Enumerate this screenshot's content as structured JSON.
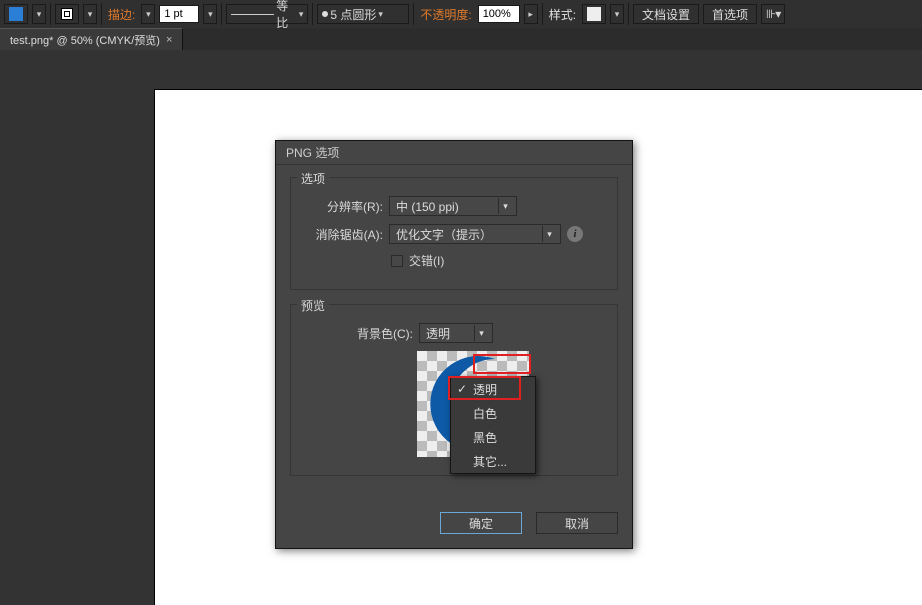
{
  "topbar": {
    "fill_color": "#2a7ed6",
    "stroke_mode_color": "#ffffff",
    "stroke_label": "描边:",
    "stroke_width": "1 pt",
    "dash_label": "等比",
    "brush_label": "5 点圆形",
    "opacity_label": "不透明度:",
    "opacity_value": "100%",
    "style_label": "样式:",
    "docsetup": "文档设置",
    "prefs": "首选项"
  },
  "tab": {
    "title": "test.png* @ 50% (CMYK/预览)"
  },
  "dialog": {
    "title": "PNG 选项",
    "group_options": "选项",
    "resolution_label": "分辨率(R):",
    "resolution_value": "中 (150 ppi)",
    "antialias_label": "消除锯齿(A):",
    "antialias_value": "优化文字（提示）",
    "interlaced_label": "交错(I)",
    "group_preview": "预览",
    "bgcolor_label": "背景色(C):",
    "bgcolor_value": "透明",
    "popup": {
      "transparent": "透明",
      "white": "白色",
      "black": "黑色",
      "other": "其它..."
    },
    "ok": "确定",
    "cancel": "取消"
  }
}
